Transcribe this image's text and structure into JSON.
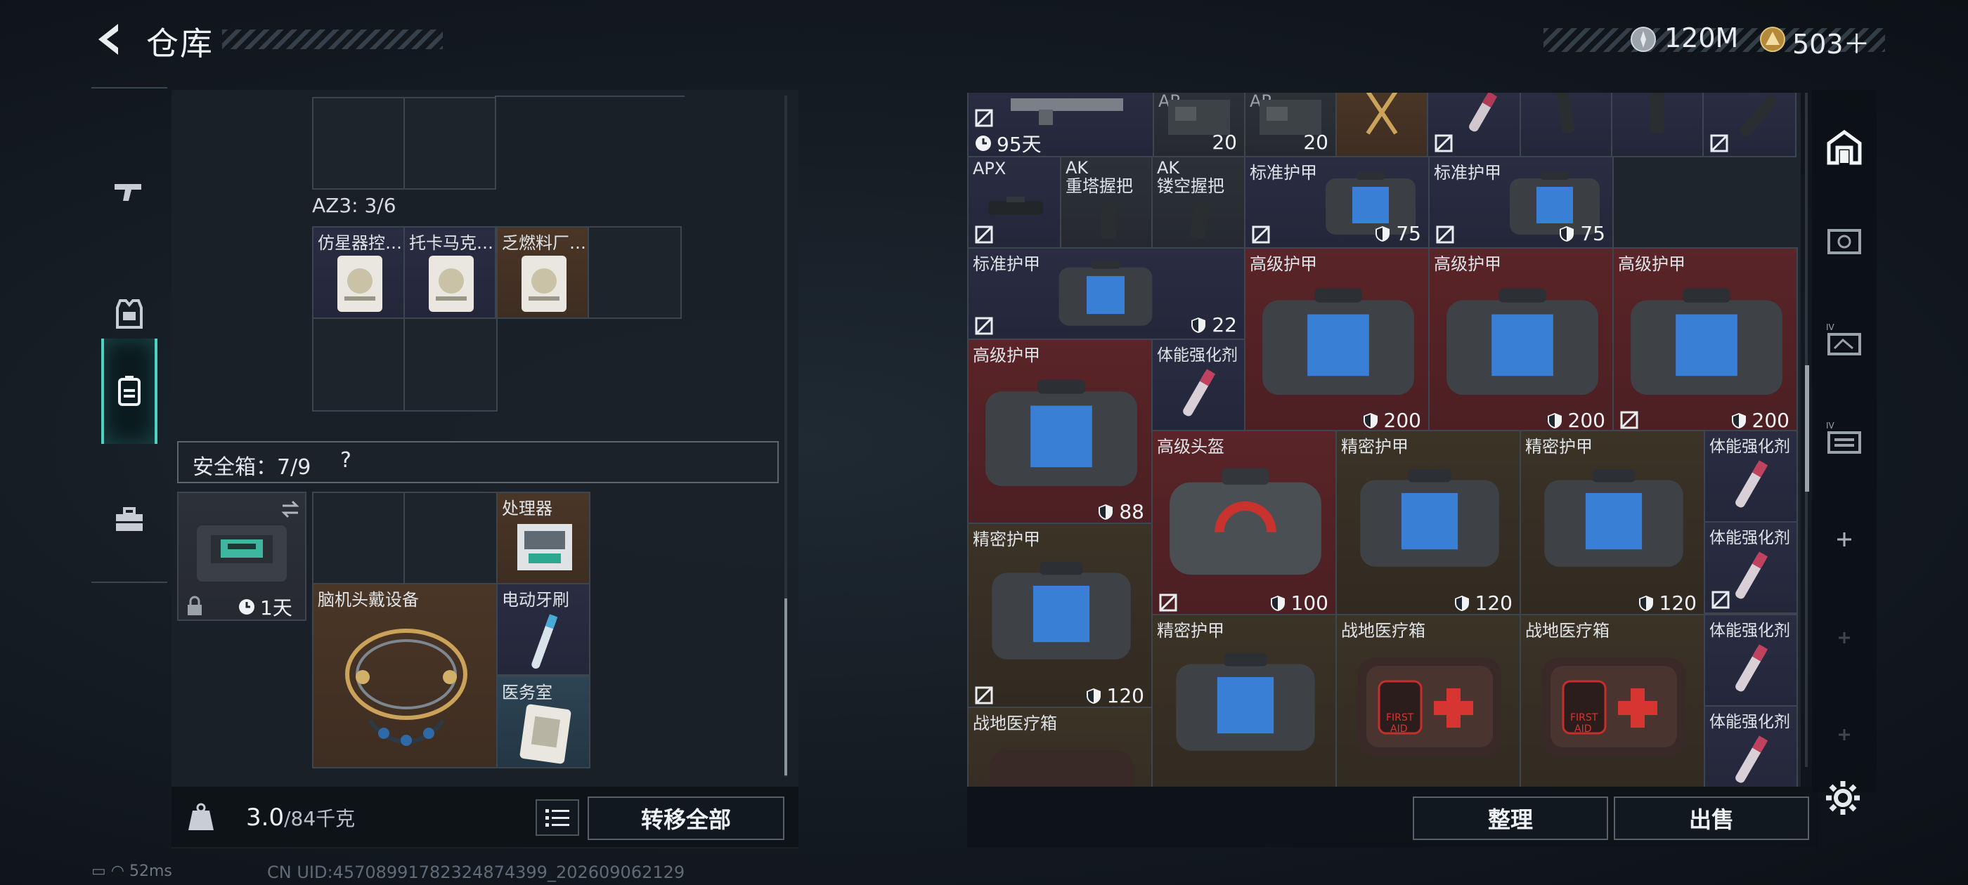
{
  "header": {
    "title": "仓库",
    "currency1": "120M",
    "currency2": "503＋"
  },
  "left": {
    "az3_label": "AZ3: 3/6",
    "az3_items": [
      {
        "name": "仿星器控…"
      },
      {
        "name": "托卡马克…"
      },
      {
        "name": "乏燃料厂…"
      }
    ],
    "safe_label": "安全箱：7/9",
    "safe_help": "?",
    "safe_case_timer": "1天",
    "safe_items": {
      "processor": "处理器",
      "headset": "脑机头戴设备",
      "toothbrush": "电动牙刷",
      "clinic": "医务室"
    },
    "weight_current": "3.0",
    "weight_max": "/84千克",
    "transfer_all": "转移全部"
  },
  "status": {
    "ping": "52ms",
    "uid": "CN UID:45708991782324874399_202609062129"
  },
  "right": {
    "row0": {
      "timer": "95天",
      "ap1_label": "AP",
      "ap1_count": "20",
      "ap2_label": "AP",
      "ap2_count": "20"
    },
    "row1": {
      "apx": "APX",
      "ak1": "AK\n重塔握把",
      "ak1_line1": "AK",
      "ak1_line2": "重塔握把",
      "ak2_line1": "AK",
      "ak2_line2": "镂空握把",
      "std1": "标准护甲",
      "std1_dur": "75",
      "std2": "标准护甲",
      "std2_dur": "75"
    },
    "row2": {
      "std3": "标准护甲",
      "std3_dur": "22",
      "adv1": "高级护甲",
      "adv1_dur": "200",
      "adv2": "高级护甲",
      "adv2_dur": "200",
      "adv3": "高级护甲",
      "adv3_dur": "200"
    },
    "row3": {
      "adv4": "高级护甲",
      "adv4_dur": "88",
      "stim1": "体能强化剂",
      "helmet": "高级头盔",
      "helmet_dur": "100",
      "prec1": "精密护甲",
      "prec1_dur": "120",
      "prec2": "精密护甲",
      "prec2_dur": "120",
      "stim2": "体能强化剂",
      "stim3": "体能强化剂"
    },
    "row4": {
      "prec3": "精密护甲",
      "prec3_dur": "120",
      "prec4": "精密护甲",
      "med1": "战地医疗箱",
      "med2": "战地医疗箱",
      "stim4": "体能强化剂",
      "stim5": "体能强化剂",
      "med3": "战地医疗箱"
    },
    "sort": "整理",
    "sell": "出售"
  },
  "colors": {
    "accent": "#4fd2c2",
    "tile_red": "#5a2428",
    "tile_purple": "#2b2b44",
    "tile_brown": "#4a3626"
  }
}
